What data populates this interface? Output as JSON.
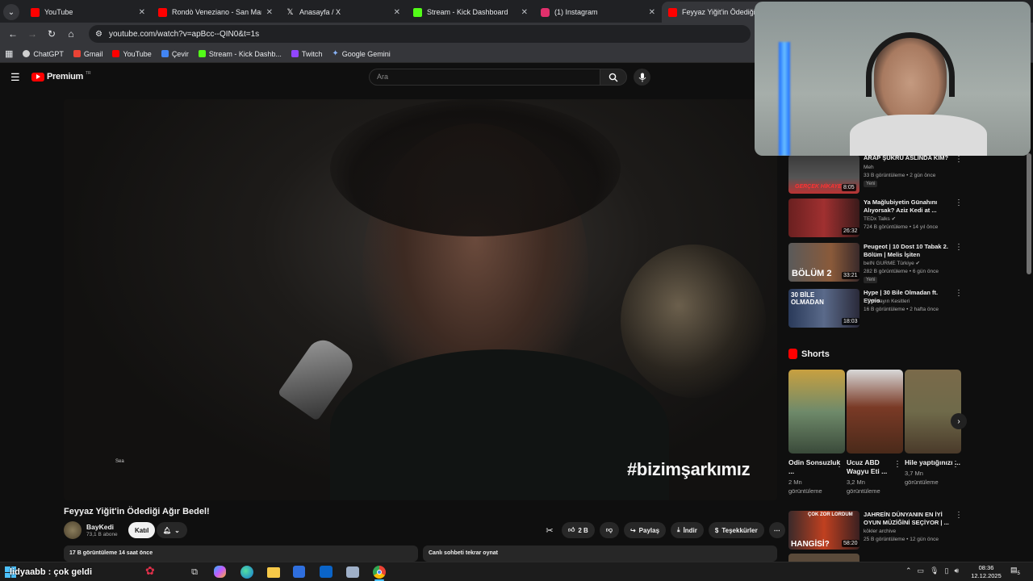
{
  "browser": {
    "tabs": [
      {
        "title": "YouTube",
        "color": "#ff0000"
      },
      {
        "title": "Rondò Veneziano - San Marco",
        "color": "#ff0000"
      },
      {
        "title": "Anasayfa / X",
        "color": "#ffffff"
      },
      {
        "title": "Stream - Kick Dashboard",
        "color": "#53fc18"
      },
      {
        "title": "(1) Instagram",
        "color": "#e1306c"
      },
      {
        "title": "Feyyaz Yiğit'in Ödediği Ağır",
        "color": "#ff0000"
      }
    ],
    "url": "youtube.com/watch?v=apBcc--QIN0&t=1s",
    "bookmarks": [
      {
        "label": "ChatGPT",
        "color": "#cfcfcf"
      },
      {
        "label": "Gmail",
        "color": "#ea4335"
      },
      {
        "label": "YouTube",
        "color": "#ff0000"
      },
      {
        "label": "Çevir",
        "color": "#4285f4"
      },
      {
        "label": "Stream - Kick Dashb...",
        "color": "#53fc18"
      },
      {
        "label": "Twitch",
        "color": "#9146ff"
      },
      {
        "label": "Google Gemini",
        "color": "#8ab4f8"
      }
    ]
  },
  "yt": {
    "logo": "Premium",
    "region": "TR",
    "search_placeholder": "Ara",
    "video_caption": "Sea",
    "watermark": "#bizimşarkımız",
    "title": "Feyyaz Yiğit'in Ödediği Ağır Bedel!",
    "channel": "BayKedi",
    "subs": "73,1 B abone",
    "join": "Katıl",
    "likes": "2 B",
    "share": "Paylaş",
    "download": "İndir",
    "thanks": "Teşekkürler",
    "views_line": "17 B görüntüleme  14 saat önce",
    "chat_replay": "Canlı sohbeti tekrar oynat"
  },
  "related": [
    {
      "title": "ARAP ŞÜKRÜ ASLINDA KİM?",
      "channel": "Meh",
      "meta": "33 B görüntüleme • 2 gün önce",
      "duration": "8:05",
      "badge": "Yeni",
      "thumb_text": "GERÇEK HİKAYE"
    },
    {
      "title": "Ya Mağlubiyetin Günahını Alıyorsak? Aziz Kedi at ...",
      "channel": "TEDx Talks",
      "meta": "724 B görüntüleme • 14 yıl önce",
      "duration": "26:32",
      "badge": ""
    },
    {
      "title": "Peugeot | 10 Dost 10 Tabak 2. Bölüm | Melis İşiten",
      "channel": "beIN GURME Türkiye",
      "meta": "282 B görüntüleme • 6 gün önce",
      "duration": "33:21",
      "badge": "Yeni",
      "thumb_text": "BÖLÜM 2"
    },
    {
      "title": "Hype | 30 Bile Olmadan ft. Eypio",
      "channel": "ETW Yayın Kesitleri",
      "meta": "16 B görüntüleme • 2 hafta önce",
      "duration": "18:03",
      "badge": "",
      "thumb_text": "30 BİLE OLMADAN"
    }
  ],
  "shorts": {
    "heading": "Shorts",
    "items": [
      {
        "title": "Odin Sonsuzluk ...",
        "views": "2 Mn",
        "views2": "görüntüleme",
        "color": "#6f8a6a"
      },
      {
        "title": "Ucuz ABD Wagyu Eti ...",
        "views": "3,2 Mn",
        "views2": "görüntüleme",
        "color": "#7a3a26"
      },
      {
        "title": "Hile yaptığınızı ...",
        "views": "3,7 Mn",
        "views2": "görüntüleme",
        "color": "#6f6a4a"
      }
    ]
  },
  "last_related": {
    "title": "JAHREİN DÜNYANIN EN İYİ OYUN MÜZİĞİNİ SEÇİYOR | ...",
    "channel": "kökler archive",
    "meta": "25 B görüntüleme • 12 gün önce",
    "duration": "58:20",
    "thumb_text": "HANGİSİ?",
    "thumb_top": "ÇOK ZOR LORDUM"
  },
  "taskbar": {
    "chat_overlay": "lidyaabb : çok geldi",
    "time": "08:36",
    "date": "12.12.2025",
    "notif": "5"
  }
}
